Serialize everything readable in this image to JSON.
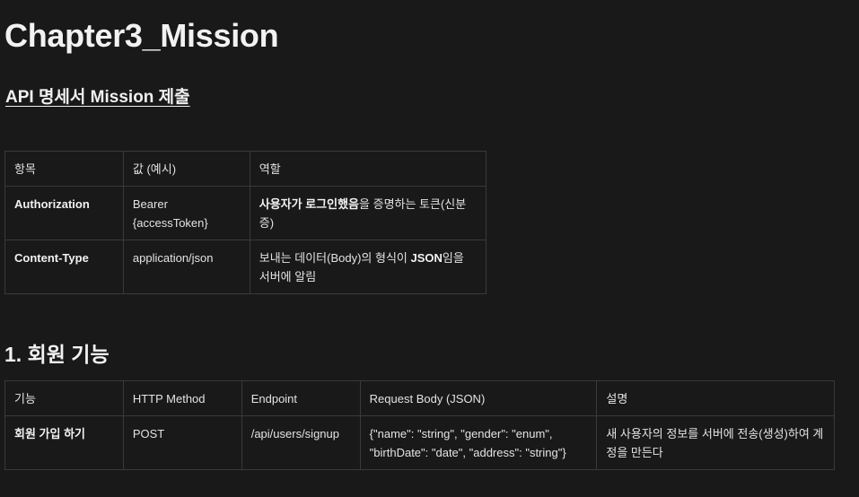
{
  "page": {
    "title": "Chapter3_Mission",
    "link_heading": "API 명세서 Mission 제출"
  },
  "headers_table": {
    "columns": [
      "항목",
      "값 (예시)",
      "역할"
    ],
    "rows": [
      {
        "item": "Authorization",
        "value": "Bearer {accessToken}",
        "role_bold": "사용자가 로그인했음",
        "role_rest": "을 증명하는 토큰(신분증)"
      },
      {
        "item": "Content-Type",
        "value": "application/json",
        "role_pre": "보내는 데이터(Body)의 형식이 ",
        "role_bold": "JSON",
        "role_rest": "임을 서버에 알림"
      }
    ]
  },
  "section": {
    "heading": "1. 회원 기능"
  },
  "features_table": {
    "columns": [
      "기능",
      "HTTP Method",
      "Endpoint",
      "Request Body (JSON)",
      "설명"
    ],
    "rows": [
      {
        "feature": "회원 가입 하기",
        "method": "POST",
        "endpoint": "/api/users/signup",
        "body": "{\"name\": \"string\", \"gender\": \"enum\", \"birthDate\": \"date\", \"address\": \"string\"}",
        "description": "새 사용자의 정보를 서버에 전송(생성)하여 계정을 만든다"
      }
    ]
  }
}
